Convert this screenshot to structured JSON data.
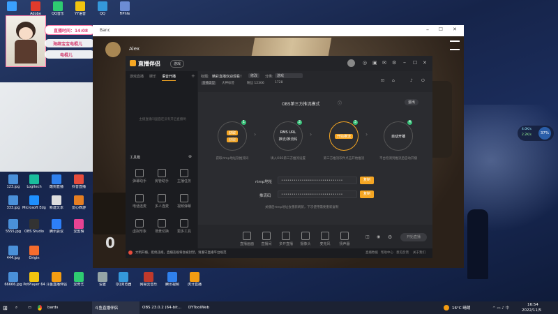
{
  "desktop": {
    "icons": [
      {
        "label": "",
        "color": "#3aa0ff"
      },
      {
        "label": "Adobe",
        "color": "#e03b2c"
      },
      {
        "label": "QQ音乐",
        "color": "#2ecc71"
      },
      {
        "label": "YY语音",
        "color": "#f1c40f"
      },
      {
        "label": "QQ",
        "color": "#3498db"
      },
      {
        "label": "FiPhfe",
        "color": "#6c8cd5"
      },
      {
        "label": "123.jpg",
        "color": "#4a90d9"
      },
      {
        "label": "Logitech",
        "color": "#1abc9c"
      },
      {
        "label": "酷狗直播",
        "color": "#2f80ed"
      },
      {
        "label": "抖音直播",
        "color": "#e74c3c"
      },
      {
        "label": "333.jpg",
        "color": "#4a90d9"
      },
      {
        "label": "Microsoft Edge",
        "color": "#1e90ff"
      },
      {
        "label": "新建文本",
        "color": "#dddddd"
      },
      {
        "label": "爱心西游",
        "color": "#e67e22"
      },
      {
        "label": "5555.jpg",
        "color": "#4a90d9"
      },
      {
        "label": "OBS Studio",
        "color": "#333333"
      },
      {
        "label": "腾讯会议",
        "color": "#2d7ff9"
      },
      {
        "label": "爱剪辑",
        "color": "#e84393"
      },
      {
        "label": "444.jpg",
        "color": "#4a90d9"
      },
      {
        "label": "Origin",
        "color": "#f56c2d"
      },
      {
        "label": "66666.jpg",
        "color": "#4a90d9"
      },
      {
        "label": "PotPlayer 64",
        "color": "#f1c40f"
      },
      {
        "label": "斗鱼直播伴侣",
        "color": "#f39c12"
      },
      {
        "label": "爱奇艺",
        "color": "#2ecc71"
      },
      {
        "label": "设置",
        "color": "#95a5a6"
      },
      {
        "label": "QQ浏览器",
        "color": "#3498db"
      },
      {
        "label": "网易云音乐",
        "color": "#c0392b"
      },
      {
        "label": "腾讯视频",
        "color": "#2f80ed"
      },
      {
        "label": "虎牙直播",
        "color": "#f39c12"
      }
    ]
  },
  "overlay": {
    "stream_time_label": "直播时间：14:08",
    "name1": "海绵宝宝电棍儿",
    "name2": "电棍儿"
  },
  "browser": {
    "tab_title": "Banc"
  },
  "game": {
    "player_name": "Alex",
    "ammo": "0"
  },
  "app": {
    "logo": "直播伴侣",
    "version_badge": "游戏",
    "left_tabs": [
      "游戏直播",
      "娱乐",
      "语音开播"
    ],
    "left_note": "主播直播间里面还没有开启直播哟",
    "toolbox_label": "工具箱",
    "tools": [
      "弹幕助手",
      "房管助手",
      "主播任务",
      "电话连麦",
      "多人连麦",
      "视频弹幕",
      "虚拟形象",
      "场景切换",
      "更多工具"
    ],
    "room_title_prefix": "标题:",
    "room_title": "精彩直播欢迎观看！",
    "edit_label": "修改",
    "category_label": "分类:",
    "category_value": "游戏",
    "sub_tags": [
      "直播类型",
      "大神标签"
    ],
    "stat_fans": "粉丝 12306",
    "stat_hot": "1728",
    "mode_title": "OBS第三方推流模式",
    "exit_button": "退出",
    "steps": [
      {
        "num": "1",
        "top": "获取",
        "bottom": "获取",
        "desc": "获取rtmp地址及推流码"
      },
      {
        "num": "2",
        "top": "RMS URL",
        "bottom": "推流/推流码",
        "desc": "填入OBS第三方推流设置"
      },
      {
        "num": "3",
        "top": "开始推流",
        "bottom": "",
        "desc": "第三方推流软件点击开始推流"
      },
      {
        "num": "4",
        "top": "自动开播",
        "bottom": "",
        "desc": "平台检测到推流后自动开播"
      }
    ],
    "rtmp_label": "rtmp地址",
    "rtmp_value": "••••••••••••••••••••••••••••••",
    "rtmp_copy": "复制",
    "key_label": "推流码",
    "key_value": "••••••••••••••••••••••••••••••",
    "key_copy": "复制",
    "hint": "关播后rtmp地址会重新刷新，下次使用需要重新复制",
    "bottom_tools": [
      "直播画面",
      "直播间",
      "多开直播",
      "摄像头",
      "麦克风",
      "扬声器"
    ],
    "go_live_button": "开始直播",
    "footer_notice": "文明开播，拒绝违规，直播违规将会被封禁，请遵守直播平台规范",
    "footer_right": [
      "直播数据",
      "帮助中心",
      "意见反馈",
      "关于我们"
    ]
  },
  "weather_widget": {
    "temp1": "4.0K/s",
    "temp2": "2.2K/s",
    "percent": "37%"
  },
  "taskbar": {
    "items": [
      "bards",
      "斗鱼直播伴侣",
      "OBS 23.0.2 (64-bit...",
      "DYToolWeb"
    ],
    "weather": "16°C 晴朗",
    "time": "16:54",
    "date": "2022/11/5"
  },
  "colors": {
    "accent": "#f5a623",
    "step_badge": "#39c27a"
  }
}
